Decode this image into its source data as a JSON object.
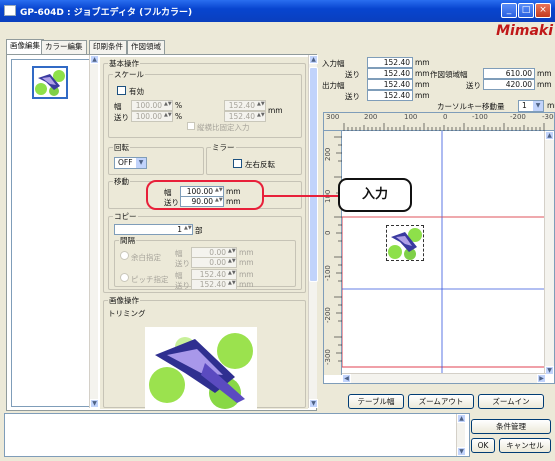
{
  "window": {
    "title": "GP-604D : ジョブエディタ (フルカラー)",
    "logo": "Mimaki",
    "min_glyph": "_",
    "max_glyph": "□",
    "close_glyph": "×"
  },
  "tabs": [
    "画像編集",
    "カラー編集",
    "印刷条件",
    "作図領域"
  ],
  "basic": {
    "group": "基本操作",
    "scale": {
      "label": "スケール",
      "enable_label": "有効",
      "width_label": "幅",
      "feed_label": "送り",
      "width_pct": "100.00",
      "feed_pct": "100.00",
      "pct_unit": "%",
      "width_mm": "152.40",
      "feed_mm": "152.40",
      "mm_unit": "mm",
      "aspect_label": "縦横比固定入力"
    },
    "rotate": {
      "label": "回転",
      "value": "OFF"
    },
    "mirror": {
      "label": "ミラー",
      "flip_label": "左右反転"
    },
    "move": {
      "label": "移動",
      "width_label": "幅",
      "feed_label": "送り",
      "width": "100.00",
      "feed": "90.00",
      "unit": "mm"
    },
    "copy": {
      "label": "コピー",
      "count": "1",
      "unit": "部",
      "spacing_label": "間隔",
      "auto_label": "余白指定",
      "pitch_label": "ピッチ指定",
      "width_label": "幅",
      "feed_label": "送り",
      "auto_w": "0.00",
      "auto_f": "0.00",
      "pitch_w": "152.40",
      "pitch_f": "152.40",
      "mm_unit": "mm"
    }
  },
  "image_ops": {
    "group": "画像操作",
    "trim_label": "トリミング"
  },
  "info": {
    "input_label": "入力",
    "output_label": "出力",
    "width_label": "幅",
    "feed_label": "送り",
    "in_w": "152.40",
    "in_f": "152.40",
    "out_w": "152.40",
    "out_f": "152.40",
    "mm_unit": "mm",
    "area_label": "作図領域",
    "area_w": "610.00",
    "area_f": "420.00",
    "cursor_label": "カーソルキー移動量",
    "cursor_value": "1",
    "cursor_unit": "mm"
  },
  "ruler": {
    "top_ticks": [
      "300",
      "200",
      "100",
      "0",
      "-100",
      "-200",
      "-300"
    ],
    "left_ticks": [
      "200",
      "100",
      "0",
      "-100",
      "-200",
      "-300"
    ]
  },
  "canvas_buttons": {
    "table_width": "テーブル幅",
    "zoom_out": "ズームアウト",
    "zoom_in": "ズームイン"
  },
  "footer": {
    "conditions": "条件管理",
    "ok": "OK",
    "cancel": "キャンセル"
  },
  "callout": {
    "text": "入力"
  },
  "colors": {
    "titlebar": "#0a3fbe",
    "logo": "#c01818",
    "guide_red": "#e04050",
    "guide_blue": "#3355dd",
    "callout_line": "#e8203a"
  }
}
